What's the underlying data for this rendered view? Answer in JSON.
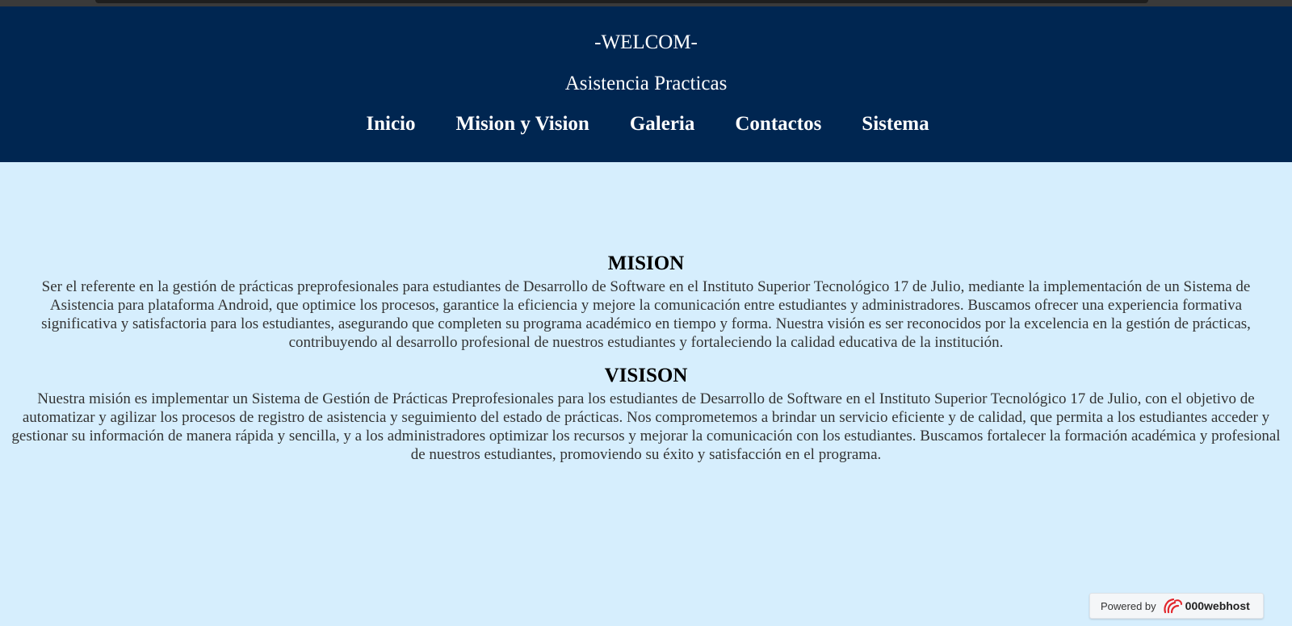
{
  "header": {
    "welcome": "-WELCOM-",
    "subtitle": "Asistencia Practicas",
    "nav": [
      "Inicio",
      "Mision y Vision",
      "Galeria",
      "Contactos",
      "Sistema"
    ]
  },
  "mision": {
    "title": "MISION",
    "text": "Ser el referente en la gestión de prácticas preprofesionales para estudiantes de Desarrollo de Software en el Instituto Superior Tecnológico 17 de Julio, mediante la implementación de un Sistema de Asistencia para plataforma Android, que optimice los procesos, garantice la eficiencia y mejore la comunicación entre estudiantes y administradores. Buscamos ofrecer una experiencia formativa significativa y satisfactoria para los estudiantes, asegurando que completen su programa académico en tiempo y forma. Nuestra visión es ser reconocidos por la excelencia en la gestión de prácticas, contribuyendo al desarrollo profesional de nuestros estudiantes y fortaleciendo la calidad educativa de la institución."
  },
  "vision": {
    "title": "VISISON",
    "text": "Nuestra misión es implementar un Sistema de Gestión de Prácticas Preprofesionales para los estudiantes de Desarrollo de Software en el Instituto Superior Tecnológico 17 de Julio, con el objetivo de automatizar y agilizar los procesos de registro de asistencia y seguimiento del estado de prácticas. Nos comprometemos a brindar un servicio eficiente y de calidad, que permita a los estudiantes acceder y gestionar su información de manera rápida y sencilla, y a los administradores optimizar los recursos y mejorar la comunicación con los estudiantes. Buscamos fortalecer la formación académica y profesional de nuestros estudiantes, promoviendo su éxito y satisfacción en el programa."
  },
  "badge": {
    "label": "Powered by",
    "brand": "000webhost",
    "icon": "000webhost-logo-icon"
  },
  "colors": {
    "header_bg": "#002651",
    "page_bg": "#d6eefd",
    "logo_red": "#e2262c"
  }
}
